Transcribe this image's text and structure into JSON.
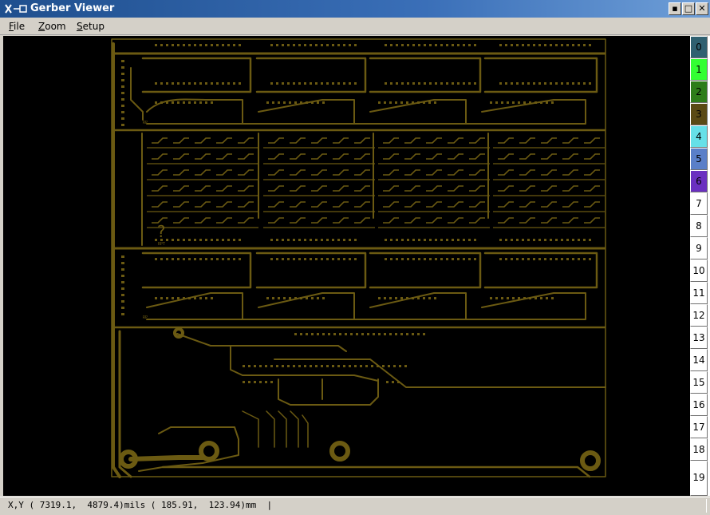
{
  "window": {
    "title": "Gerber Viewer",
    "controls": [
      "▪",
      "□",
      "✕"
    ]
  },
  "menu": [
    {
      "label": "File",
      "mnemonic": "F",
      "rest": "ile"
    },
    {
      "label": "Zoom",
      "mnemonic": "Z",
      "rest": "oom"
    },
    {
      "label": "Setup",
      "mnemonic": "S",
      "rest": "etup"
    }
  ],
  "pcb": {
    "trace_color": "#6b5a12",
    "background": "#000000",
    "silk_marks": [
      "?",
      "RPT",
      "RP",
      "RP"
    ]
  },
  "layers": [
    {
      "label": "0",
      "color": "#2f6070"
    },
    {
      "label": "1",
      "color": "#33ff33"
    },
    {
      "label": "2",
      "color": "#2e7d1a"
    },
    {
      "label": "3",
      "color": "#5a4a14"
    },
    {
      "label": "4",
      "color": "#66e0e8"
    },
    {
      "label": "5",
      "color": "#5a7fc8"
    },
    {
      "label": "6",
      "color": "#6a2fc0"
    },
    {
      "label": "7",
      "color": "#ffffff"
    },
    {
      "label": "8",
      "color": "#ffffff"
    },
    {
      "label": "9",
      "color": "#ffffff"
    },
    {
      "label": "10",
      "color": "#ffffff"
    },
    {
      "label": "11",
      "color": "#ffffff"
    },
    {
      "label": "12",
      "color": "#ffffff"
    },
    {
      "label": "13",
      "color": "#ffffff"
    },
    {
      "label": "14",
      "color": "#ffffff"
    },
    {
      "label": "15",
      "color": "#ffffff"
    },
    {
      "label": "16",
      "color": "#ffffff"
    },
    {
      "label": "17",
      "color": "#ffffff"
    },
    {
      "label": "18",
      "color": "#ffffff"
    },
    {
      "label": "19",
      "color": "#ffffff"
    }
  ],
  "status": {
    "coords": "X,Y ( 7319.1,  4879.4)mils ( 185.91,  123.94)mm  |"
  }
}
